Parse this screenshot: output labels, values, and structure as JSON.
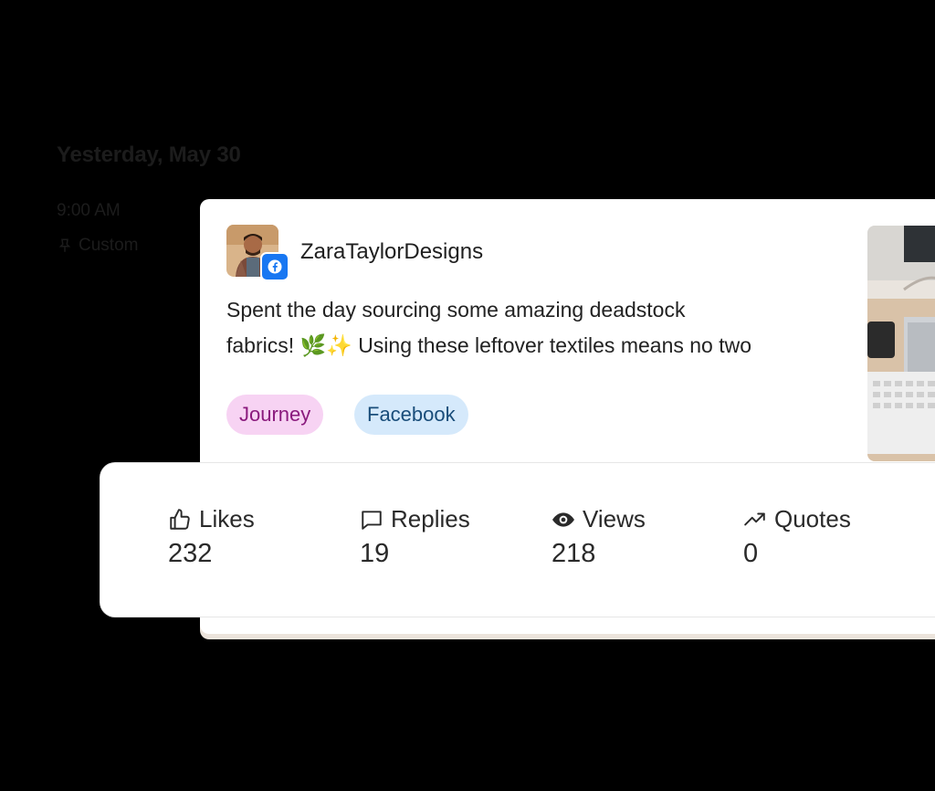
{
  "schedule": {
    "date": "Yesterday, May 30",
    "time": "9:00 AM",
    "type_label": "Custom",
    "type_icon": "pin-icon"
  },
  "post": {
    "username": "ZaraTaylorDesigns",
    "platform_icon": "facebook-icon",
    "text": "Spent the day sourcing some amazing deadstock\nfabrics! 🌿✨ Using these leftover textiles means no two",
    "tags": [
      {
        "label": "Journey",
        "color": "#f7d3f3",
        "text_color": "#8a1a7d"
      },
      {
        "label": "Facebook",
        "color": "#d5e9fb",
        "text_color": "#194d7a"
      }
    ]
  },
  "stats": {
    "likes": {
      "label": "Likes",
      "value": "232",
      "icon": "thumbs-up-icon"
    },
    "replies": {
      "label": "Replies",
      "value": "19",
      "icon": "comment-icon"
    },
    "views": {
      "label": "Views",
      "value": "218",
      "icon": "eye-icon"
    },
    "quotes": {
      "label": "Quotes",
      "value": "0",
      "icon": "trending-up-icon"
    }
  },
  "colors": {
    "background": "#000000",
    "facebook_blue": "#1877f2"
  }
}
